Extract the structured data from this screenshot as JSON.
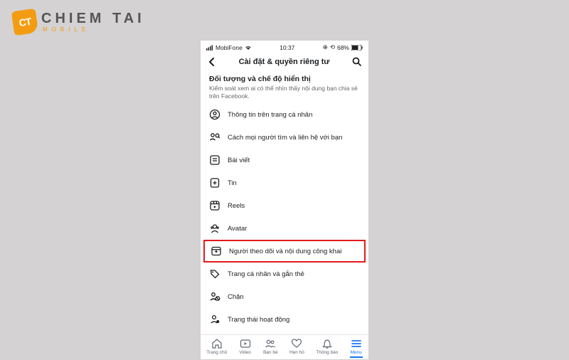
{
  "logo": {
    "badge": "CT",
    "main": "CHIEM TAI",
    "sub": "MOBILE"
  },
  "statusbar": {
    "carrier": "MobiFone",
    "time": "10:37",
    "battery": "68%"
  },
  "navbar": {
    "title": "Cài đặt & quyền riêng tư"
  },
  "section": {
    "title": "Đối tượng và chế độ hiển thị",
    "desc": "Kiểm soát xem ai có thể nhìn thấy nội dung bạn chia sẻ trên Facebook."
  },
  "rows": [
    {
      "label": "Thông tin trên trang cá nhân"
    },
    {
      "label": "Cách mọi người tìm và liên hệ với bạn"
    },
    {
      "label": "Bài viết"
    },
    {
      "label": "Tin"
    },
    {
      "label": "Reels"
    },
    {
      "label": "Avatar"
    },
    {
      "label": "Người theo dõi và nội dung công khai"
    },
    {
      "label": "Trang cá nhân và gắn thẻ"
    },
    {
      "label": "Chặn"
    },
    {
      "label": "Trạng thái hoạt động"
    }
  ],
  "tabs": [
    {
      "label": "Trang chủ"
    },
    {
      "label": "Video"
    },
    {
      "label": "Bạn bè"
    },
    {
      "label": "Hẹn hò"
    },
    {
      "label": "Thông báo"
    },
    {
      "label": "Menu"
    }
  ]
}
